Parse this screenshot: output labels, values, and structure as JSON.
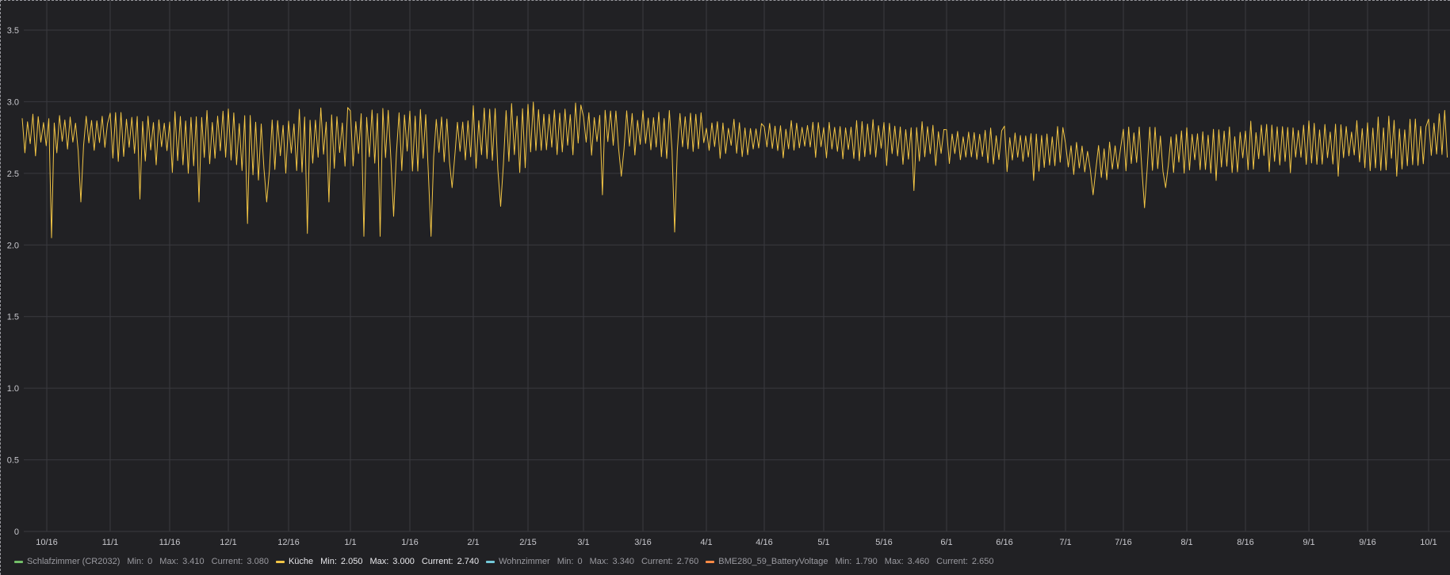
{
  "chart_data": {
    "type": "line",
    "yaxis": {
      "range": [
        0,
        3.5
      ],
      "ticks": [
        "0",
        "0.5",
        "1.0",
        "1.5",
        "2.0",
        "2.5",
        "3.0",
        "3.5"
      ]
    },
    "xaxis": {
      "ticks": [
        "10/16",
        "11/1",
        "11/16",
        "12/1",
        "12/16",
        "1/1",
        "1/16",
        "2/1",
        "2/15",
        "3/1",
        "3/16",
        "4/1",
        "4/16",
        "5/1",
        "5/16",
        "6/1",
        "6/16",
        "7/1",
        "7/16",
        "8/1",
        "8/16",
        "9/1",
        "9/16",
        "10/1"
      ]
    },
    "grid": true,
    "legend_position": "bottom-left",
    "series": [
      {
        "name": "Schlafzimmer (CR2032)",
        "color": "#73bf69",
        "visible": false,
        "values": []
      },
      {
        "name": "Küche",
        "color": "#f2c545",
        "visible": true,
        "segments": [
          {
            "from": "10/16",
            "to": "11/1",
            "high": 2.92,
            "low": 2.62,
            "dips": [
              2.05,
              2.3
            ]
          },
          {
            "from": "11/1",
            "to": "11/16",
            "high": 2.95,
            "low": 2.55,
            "dips": [
              2.32
            ]
          },
          {
            "from": "11/16",
            "to": "12/1",
            "high": 2.96,
            "low": 2.5,
            "dips": [
              2.3
            ]
          },
          {
            "from": "12/1",
            "to": "12/16",
            "high": 2.95,
            "low": 2.45,
            "dips": [
              2.15,
              2.3
            ]
          },
          {
            "from": "12/16",
            "to": "1/1",
            "high": 2.96,
            "low": 2.5,
            "dips": [
              2.08,
              2.3
            ]
          },
          {
            "from": "1/1",
            "to": "1/16",
            "high": 2.96,
            "low": 2.5,
            "dips": [
              2.06,
              2.06,
              2.2
            ]
          },
          {
            "from": "1/16",
            "to": "2/1",
            "high": 2.97,
            "low": 2.5,
            "dips": [
              2.06,
              2.4
            ]
          },
          {
            "from": "2/1",
            "to": "2/15",
            "high": 2.99,
            "low": 2.5,
            "dips": [
              2.27
            ]
          },
          {
            "from": "2/15",
            "to": "3/1",
            "high": 3.0,
            "low": 2.62,
            "dips": []
          },
          {
            "from": "3/1",
            "to": "3/16",
            "high": 2.95,
            "low": 2.62,
            "dips": [
              2.35,
              2.48
            ]
          },
          {
            "from": "3/16",
            "to": "4/1",
            "high": 2.95,
            "low": 2.6,
            "dips": [
              2.09
            ]
          },
          {
            "from": "4/1",
            "to": "4/16",
            "high": 2.88,
            "low": 2.6,
            "dips": []
          },
          {
            "from": "4/16",
            "to": "5/1",
            "high": 2.87,
            "low": 2.6,
            "dips": []
          },
          {
            "from": "5/1",
            "to": "5/16",
            "high": 2.88,
            "low": 2.58,
            "dips": []
          },
          {
            "from": "5/16",
            "to": "6/1",
            "high": 2.87,
            "low": 2.55,
            "dips": [
              2.38
            ]
          },
          {
            "from": "6/1",
            "to": "6/16",
            "high": 2.82,
            "low": 2.55,
            "dips": []
          },
          {
            "from": "6/16",
            "to": "7/1",
            "high": 2.83,
            "low": 2.5,
            "dips": [
              2.45
            ]
          },
          {
            "from": "7/1",
            "to": "7/16",
            "high": 2.72,
            "low": 2.45,
            "dips": [
              2.35
            ]
          },
          {
            "from": "7/16",
            "to": "8/1",
            "high": 2.83,
            "low": 2.5,
            "dips": [
              2.26,
              2.4
            ]
          },
          {
            "from": "8/1",
            "to": "8/16",
            "high": 2.83,
            "low": 2.5,
            "dips": [
              2.45
            ]
          },
          {
            "from": "8/16",
            "to": "9/1",
            "high": 2.87,
            "low": 2.5,
            "dips": []
          },
          {
            "from": "9/1",
            "to": "9/16",
            "high": 2.88,
            "low": 2.5,
            "dips": [
              2.48
            ]
          },
          {
            "from": "9/16",
            "to": "10/1",
            "high": 2.9,
            "low": 2.5,
            "dips": [
              2.48
            ]
          },
          {
            "from": "10/1",
            "to": "end",
            "high": 2.95,
            "low": 2.52,
            "dips": []
          }
        ]
      },
      {
        "name": "Wohnzimmer",
        "color": "#8ab8ff",
        "visible": false,
        "values": []
      },
      {
        "name": "BME280_59_BatteryVoltage",
        "color": "#ff9830",
        "visible": false,
        "values": []
      }
    ]
  },
  "legend": [
    {
      "name": "Schlafzimmer (CR2032)",
      "color": "#73bf69",
      "min_label": "Min:",
      "min": "0",
      "max_label": "Max:",
      "max": "3.410",
      "current_label": "Current:",
      "current": "3.080"
    },
    {
      "name": "Küche",
      "color": "#f2c545",
      "min_label": "Min:",
      "min": "2.050",
      "max_label": "Max:",
      "max": "3.000",
      "current_label": "Current:",
      "current": "2.740"
    },
    {
      "name": "Wohnzimmer",
      "color": "#73c9d9",
      "min_label": "Min:",
      "min": "0",
      "max_label": "Max:",
      "max": "3.340",
      "current_label": "Current:",
      "current": "2.760"
    },
    {
      "name": "BME280_59_BatteryVoltage",
      "color": "#ff8a45",
      "min_label": "Min:",
      "min": "1.790",
      "max_label": "Max:",
      "max": "3.460",
      "current_label": "Current:",
      "current": "2.650"
    }
  ]
}
